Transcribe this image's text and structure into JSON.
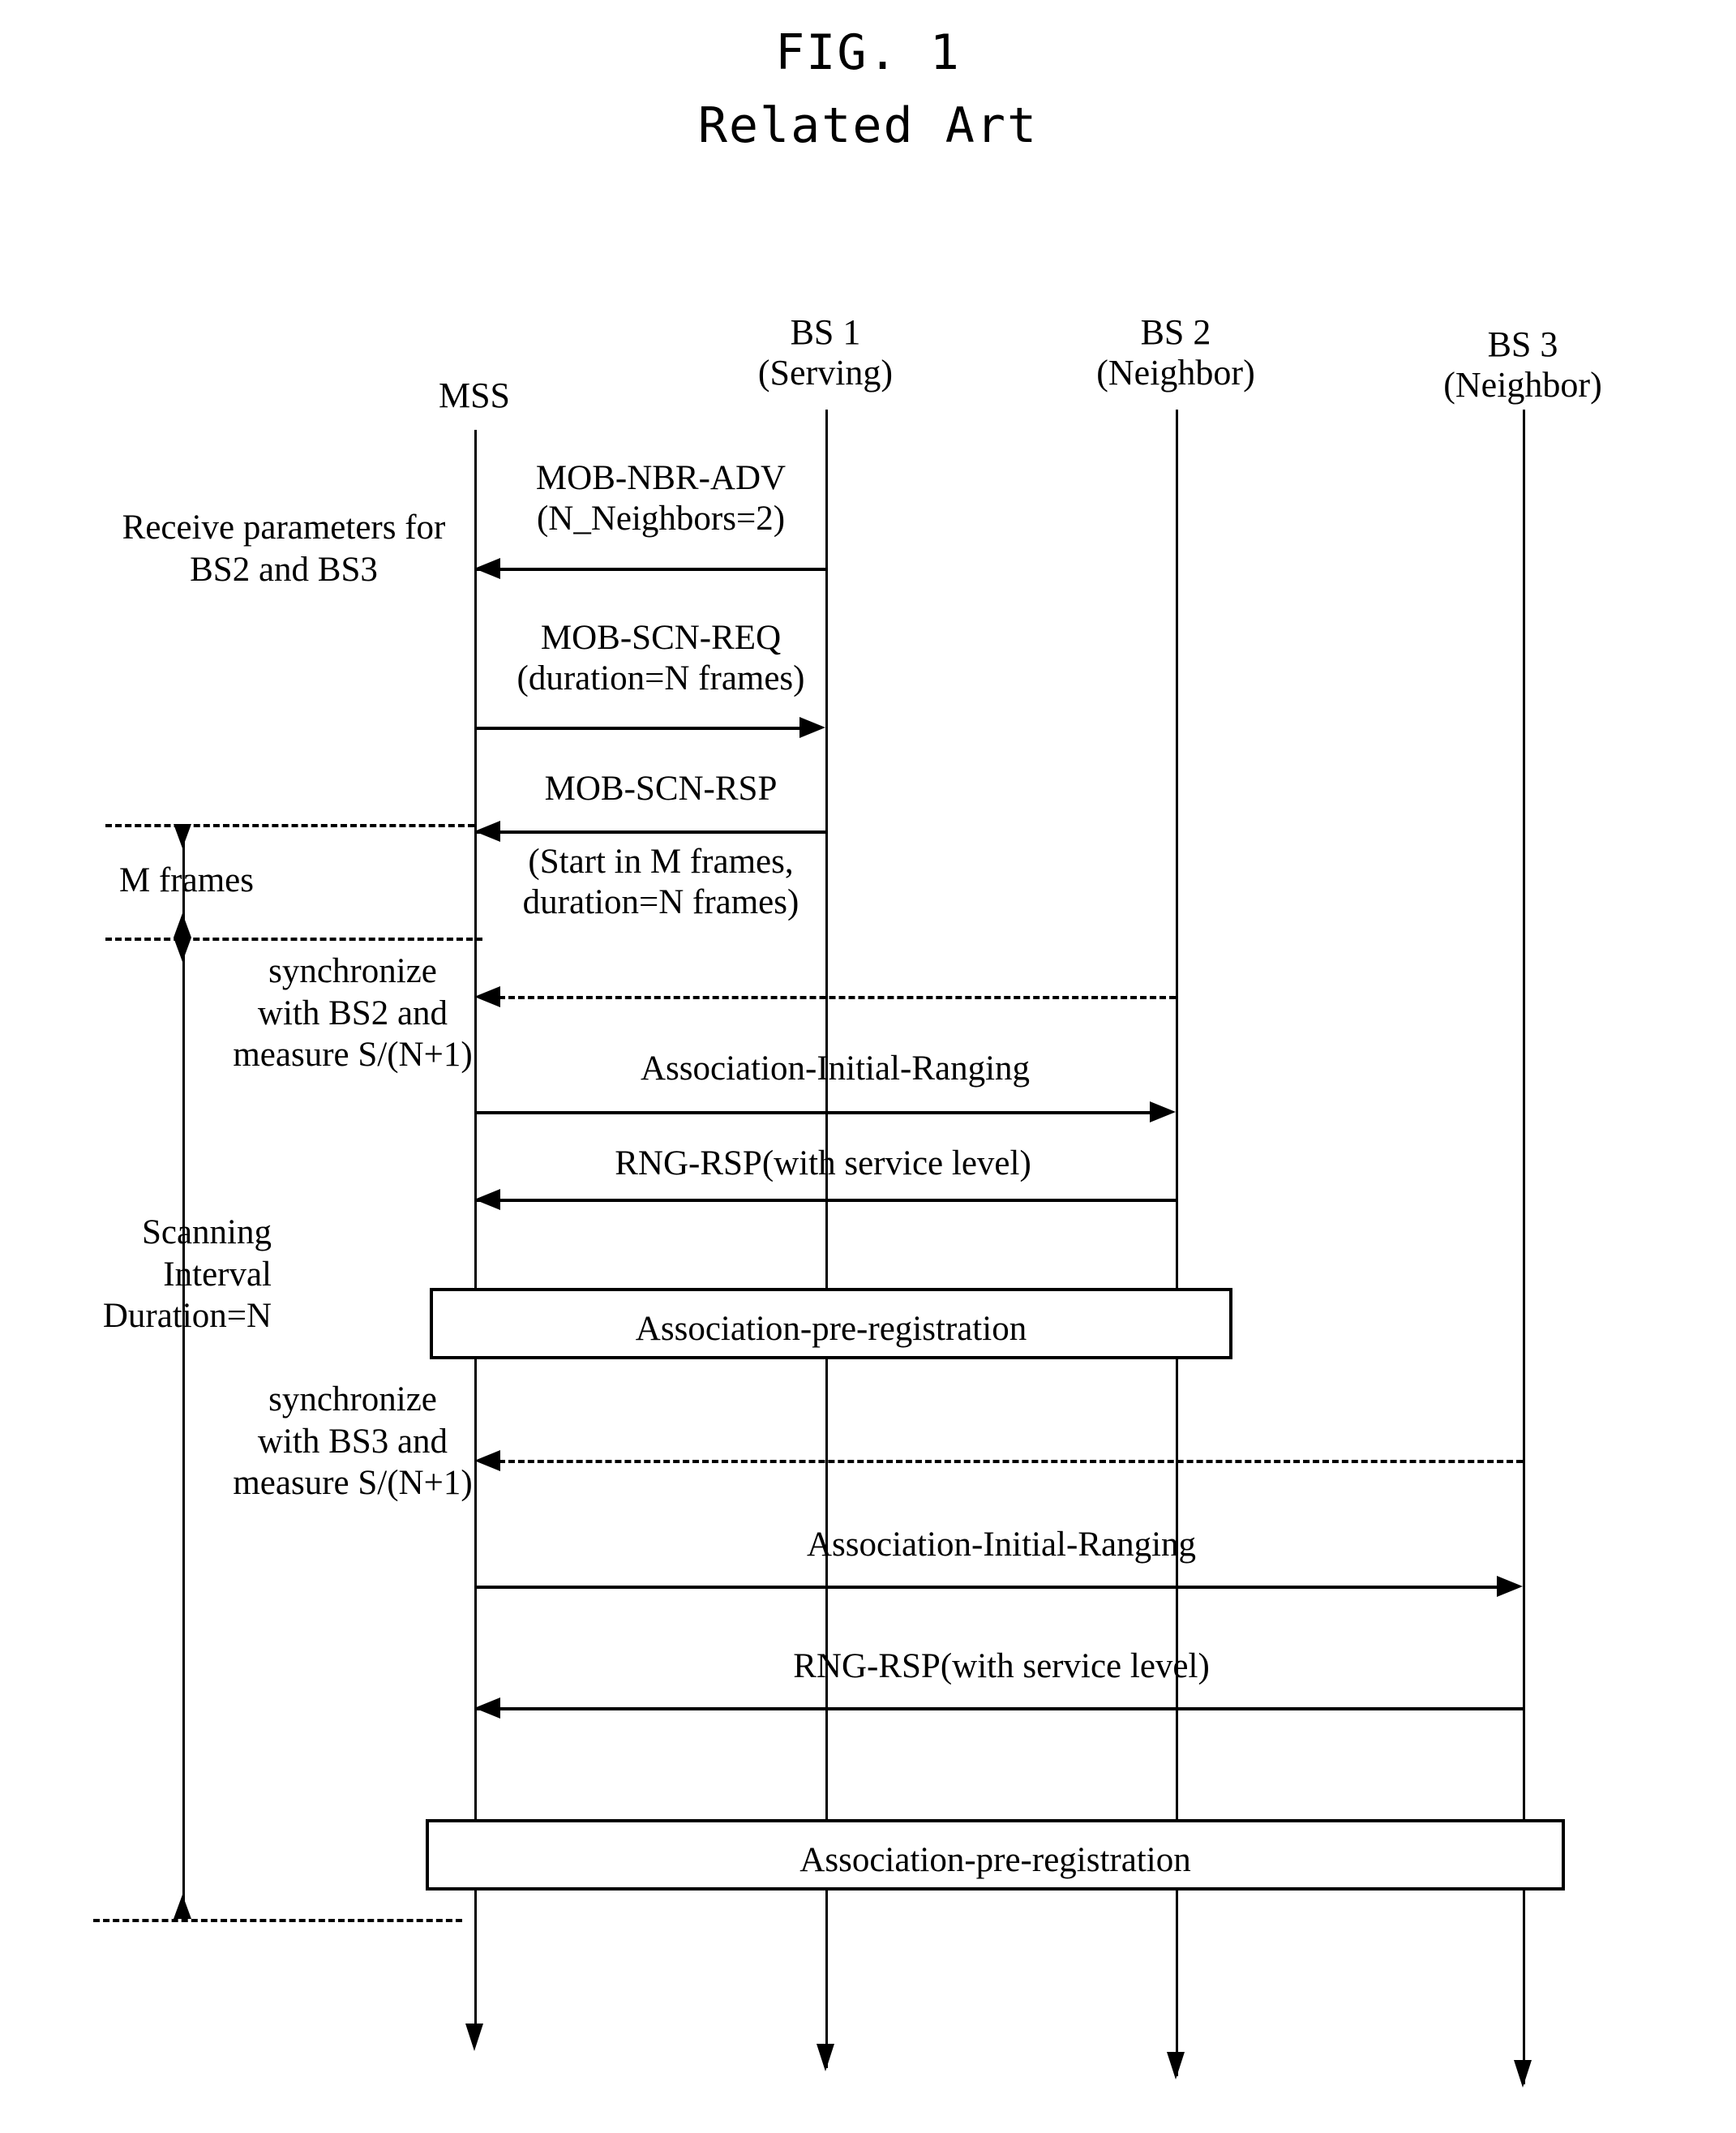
{
  "figure": {
    "title": "FIG. 1",
    "subtitle": "Related Art",
    "type": "sequence-diagram"
  },
  "lifelines": [
    {
      "id": "mss",
      "name_line1": "MSS",
      "name_line2": ""
    },
    {
      "id": "bs1",
      "name_line1": "BS 1",
      "name_line2": "(Serving)"
    },
    {
      "id": "bs2",
      "name_line1": "BS 2",
      "name_line2": "(Neighbor)"
    },
    {
      "id": "bs3",
      "name_line1": "BS 3",
      "name_line2": "(Neighbor)"
    }
  ],
  "messages": [
    {
      "id": "mob-nbr-adv",
      "line1": "MOB-NBR-ADV",
      "line2": "(N_Neighbors=2)",
      "from": "bs1",
      "to": "mss",
      "direction": "left",
      "style": "solid"
    },
    {
      "id": "mob-scn-req",
      "line1": "MOB-SCN-REQ",
      "line2": "(duration=N frames)",
      "from": "mss",
      "to": "bs1",
      "direction": "right",
      "style": "solid"
    },
    {
      "id": "mob-scn-rsp",
      "line1": "MOB-SCN-RSP",
      "line2": "(Start in M frames,",
      "line3": "duration=N frames)",
      "from": "bs1",
      "to": "mss",
      "direction": "left",
      "style": "solid"
    },
    {
      "id": "sync-bs2",
      "line1": "",
      "from": "bs2",
      "to": "mss",
      "direction": "left",
      "style": "dashed"
    },
    {
      "id": "assoc-init-ranging-bs2",
      "line1": "Association-Initial-Ranging",
      "from": "mss",
      "to": "bs2",
      "direction": "right",
      "style": "solid"
    },
    {
      "id": "rng-rsp-bs2",
      "line1": "RNG-RSP(with service level)",
      "from": "bs2",
      "to": "mss",
      "direction": "left",
      "style": "solid"
    },
    {
      "id": "sync-bs3",
      "line1": "",
      "from": "bs3",
      "to": "mss",
      "direction": "left",
      "style": "dashed"
    },
    {
      "id": "assoc-init-ranging-bs3",
      "line1": "Association-Initial-Ranging",
      "from": "mss",
      "to": "bs3",
      "direction": "right",
      "style": "solid"
    },
    {
      "id": "rng-rsp-bs3",
      "line1": "RNG-RSP(with service level)",
      "from": "bs3",
      "to": "mss",
      "direction": "left",
      "style": "solid"
    }
  ],
  "boxes": [
    {
      "id": "assoc-pre-reg-1",
      "label": "Association-pre-registration",
      "spans": "mss-to-bs2"
    },
    {
      "id": "assoc-pre-reg-2",
      "label": "Association-pre-registration",
      "spans": "mss-to-bs3"
    }
  ],
  "annotations": {
    "receive_params": {
      "line1": "Receive parameters for",
      "line2": "BS2 and BS3"
    },
    "m_frames": {
      "label": "M frames"
    },
    "sync_bs2": {
      "line1": "synchronize",
      "line2": "with BS2 and",
      "line3": "measure S/(N+1)"
    },
    "sync_bs3": {
      "line1": "synchronize",
      "line2": "with BS3 and",
      "line3": "measure S/(N+1)"
    },
    "scanning_interval": {
      "line1": "Scanning",
      "line2": "Interval",
      "line3": "Duration=N"
    }
  },
  "colors": {
    "ink": "#000000",
    "paper": "#ffffff"
  }
}
